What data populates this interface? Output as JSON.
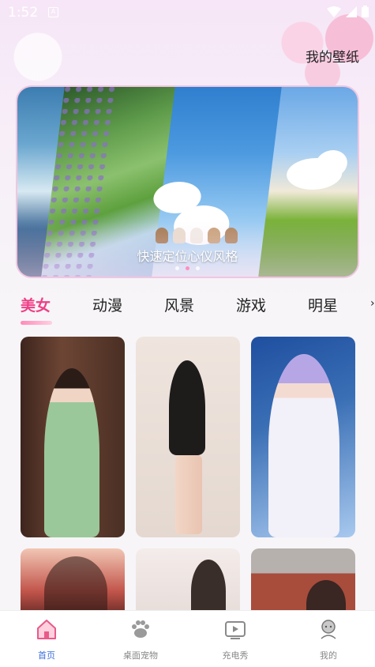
{
  "status_bar": {
    "time": "1:52",
    "notification_icon": "A"
  },
  "header": {
    "link_label": "我的壁纸"
  },
  "banner": {
    "caption": "快速定位心仪风格",
    "dots": 3,
    "active_dot": 1
  },
  "tabs": [
    {
      "label": "美女",
      "active": true
    },
    {
      "label": "动漫",
      "active": false
    },
    {
      "label": "风景",
      "active": false
    },
    {
      "label": "游戏",
      "active": false
    },
    {
      "label": "明星",
      "active": false
    }
  ],
  "wallpapers": [
    {
      "name": "wallpaper-green-qipao",
      "palette": [
        "#4a2f24",
        "#7a4d3a",
        "#9bc89a"
      ]
    },
    {
      "name": "wallpaper-black-dress",
      "palette": [
        "#e8ddd6",
        "#efe5de",
        "#1e1b1b"
      ]
    },
    {
      "name": "wallpaper-white-cosplay",
      "palette": [
        "#3a6fb5",
        "#a8c9ef",
        "#f2f0f8"
      ]
    },
    {
      "name": "wallpaper-red-portrait",
      "palette": [
        "#5a2420",
        "#c2554b",
        "#f1c6b4"
      ]
    },
    {
      "name": "wallpaper-white-bed",
      "palette": [
        "#f4ecea",
        "#e6dcd8",
        "#3a2e2a"
      ]
    },
    {
      "name": "wallpaper-temple",
      "palette": [
        "#b7b1ae",
        "#a84c3c",
        "#f0ddd2"
      ]
    }
  ],
  "bottom_nav": [
    {
      "label": "首页",
      "icon": "home-icon",
      "active": true
    },
    {
      "label": "桌面宠物",
      "icon": "paw-icon",
      "active": false
    },
    {
      "label": "充电秀",
      "icon": "video-icon",
      "active": false
    },
    {
      "label": "我的",
      "icon": "profile-icon",
      "active": false
    }
  ],
  "colors": {
    "accent": "#ef3f86",
    "nav_active": "#3c6fdc"
  }
}
